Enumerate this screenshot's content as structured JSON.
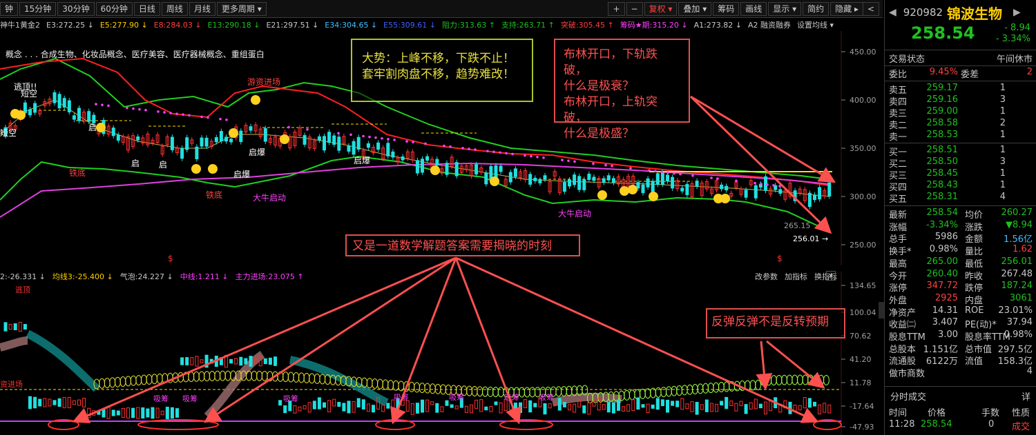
{
  "toolbar": {
    "left": [
      "钟",
      "15分钟",
      "30分钟",
      "60分钟",
      "日线",
      "周线",
      "月线",
      "更多周期 ▾"
    ],
    "right": [
      "+",
      "−",
      "复权 ▾",
      "叠加 ▾",
      "筹码",
      "画线",
      "显示 ▾",
      "简约",
      "隐藏 ▸"
    ],
    "collapse": "<"
  },
  "indicator_line": [
    {
      "text": "神牛1黄金2",
      "color": "#c8c8c8"
    },
    {
      "text": "E3:272.25 ↓",
      "color": "#c8c8c8"
    },
    {
      "text": "E5:277.90 ↓",
      "color": "#ffd000"
    },
    {
      "text": "E8:284.03 ↓",
      "color": "#ff4040"
    },
    {
      "text": "E13:290.18 ↓",
      "color": "#20c020"
    },
    {
      "text": "E21:297.51 ↓",
      "color": "#c8c8c8"
    },
    {
      "text": "E34:304.65 ↓",
      "color": "#40c0ff"
    },
    {
      "text": "E55:309.61 ↓",
      "color": "#4060ff"
    },
    {
      "text": "阻力:313.63 ↑",
      "color": "#20c020"
    },
    {
      "text": "支持:263.71 ↑",
      "color": "#20c020"
    },
    {
      "text": "突破:305.45 ↑",
      "color": "#ff4040"
    },
    {
      "text": "筹码★期:315.20 ↓",
      "color": "#ff40ff"
    },
    {
      "text": "A1:273.82 ↓",
      "color": "#c8c8c8"
    },
    {
      "text": "A2 融资融券",
      "color": "#c8c8c8"
    },
    {
      "text": "设置均线 ▾",
      "color": "#c8c8c8"
    }
  ],
  "main_chart": {
    "y_ticks": [
      "450.00",
      "400.00",
      "350.00",
      "300.00",
      "250.00"
    ],
    "concept_text": "概念 . . . 合成生物、化妆品概念、医疗美容、医疗器械概念、重组蛋白",
    "labels": [
      "逃顶!!",
      "短空",
      "短空",
      "启",
      "启",
      "启",
      "启爆",
      "启爆",
      "启爆",
      "游资进场",
      "铁底",
      "铁底",
      "大牛启动",
      "大牛启动"
    ],
    "price_labels": [
      "265.15",
      "256.01"
    ],
    "s_markers": [
      "$",
      "$"
    ]
  },
  "sub_chart": {
    "header": [
      {
        "text": "2:-26.331 ↓",
        "color": "#c8c8c8"
      },
      {
        "text": "均线3:-25.400 ↓",
        "color": "#ffd000"
      },
      {
        "text": "气泡:24.227 ↓",
        "color": "#c8c8c8"
      },
      {
        "text": "中线:1.211 ↓",
        "color": "#ff40ff"
      },
      {
        "text": "主力进场:23.075 ↑",
        "color": "#ff40ff"
      }
    ],
    "header_right": [
      "改参数",
      "加指标",
      "换指标"
    ],
    "y_ticks": [
      "134.65",
      "100.04",
      "70.62",
      "41.20",
      "11.78",
      "-17.64",
      "-47.93"
    ],
    "labels": [
      "逃顶",
      "资进场",
      "吸筹",
      "吸筹",
      "吸筹",
      "吸筹",
      "吸筹",
      "吸筹",
      "吸筹"
    ]
  },
  "annotations": {
    "a1": [
      "大势：上峰不移，下跌不止！",
      "套牢割肉盘不移，趋势难改！"
    ],
    "a2": [
      "布林开口，下轨跌破，",
      "什么是极衰？",
      "布林开口，上轨突破，",
      "什么是极盛？"
    ],
    "a3": "又是一道数学解题答案需要揭晓的时刻",
    "a4": "反弹反弹不是反转预期"
  },
  "quote": {
    "code": "920982",
    "name": "锦波生物",
    "price": "258.54",
    "change": "- 8.94",
    "change_pct": "- 3.34%",
    "status_label": "交易状态",
    "status_value": "午间休市",
    "weibi_label": "委比",
    "weibi_value": "9.45%",
    "weicha_label": "委差",
    "weicha_value": "2",
    "asks": [
      {
        "label": "卖五",
        "price": "259.17",
        "qty": "1"
      },
      {
        "label": "卖四",
        "price": "259.16",
        "qty": "3"
      },
      {
        "label": "卖三",
        "price": "259.00",
        "qty": "1"
      },
      {
        "label": "卖二",
        "price": "258.58",
        "qty": "2"
      },
      {
        "label": "卖一",
        "price": "258.53",
        "qty": "1"
      }
    ],
    "bids": [
      {
        "label": "买一",
        "price": "258.51",
        "qty": "1"
      },
      {
        "label": "买二",
        "price": "258.50",
        "qty": "3"
      },
      {
        "label": "买三",
        "price": "258.45",
        "qty": "1"
      },
      {
        "label": "买四",
        "price": "258.43",
        "qty": "1"
      },
      {
        "label": "买五",
        "price": "258.31",
        "qty": "4"
      }
    ],
    "stats": [
      {
        "l1": "最新",
        "v1": "258.54",
        "c1": "g",
        "l2": "均价",
        "v2": "260.27",
        "c2": "g"
      },
      {
        "l1": "涨幅",
        "v1": "-3.34%",
        "c1": "g",
        "l2": "涨跌",
        "v2": "▼8.94",
        "c2": "g"
      },
      {
        "l1": "总手",
        "v1": "5986",
        "c1": "w",
        "l2": "金额",
        "v2": "1.56亿",
        "c2": "c"
      },
      {
        "l1": "换手*",
        "v1": "0.98%",
        "c1": "w",
        "l2": "量比",
        "v2": "1.62",
        "c2": "r"
      },
      {
        "l1": "最高",
        "v1": "265.00",
        "c1": "g",
        "l2": "最低",
        "v2": "256.01",
        "c2": "g"
      },
      {
        "l1": "今开",
        "v1": "260.40",
        "c1": "g",
        "l2": "昨收",
        "v2": "267.48",
        "c2": "w"
      },
      {
        "l1": "涨停",
        "v1": "347.72",
        "c1": "r",
        "l2": "跌停",
        "v2": "187.24",
        "c2": "g"
      },
      {
        "l1": "外盘",
        "v1": "2925",
        "c1": "r",
        "l2": "内盘",
        "v2": "3061",
        "c2": "g"
      },
      {
        "l1": "净资产",
        "v1": "14.31",
        "c1": "w",
        "l2": "ROE",
        "v2": "23.01%",
        "c2": "w"
      },
      {
        "l1": "收益㈡",
        "v1": "3.407",
        "c1": "w",
        "l2": "PE(动)*",
        "v2": "37.94",
        "c2": "w"
      },
      {
        "l1": "股息TTM",
        "v1": "3.00",
        "c1": "w",
        "l2": "股息率TTM",
        "v2": "0.98%",
        "c2": "w"
      },
      {
        "l1": "总股本",
        "v1": "1.151亿",
        "c1": "w",
        "l2": "总市值",
        "v2": "297.5亿",
        "c2": "w"
      },
      {
        "l1": "流通股",
        "v1": "6122万",
        "c1": "w",
        "l2": "流值",
        "v2": "158.3亿",
        "c2": "w"
      },
      {
        "l1": "做市商数",
        "v1": "",
        "c1": "w",
        "l2": "",
        "v2": "4",
        "c2": "w"
      }
    ],
    "ticks_title": "分时成交",
    "ticks_detail": "详",
    "ticks_head": [
      "时间",
      "价格",
      "手数",
      "性质"
    ],
    "ticks_row": [
      "11:28",
      "258.54",
      "0",
      "成交"
    ]
  }
}
